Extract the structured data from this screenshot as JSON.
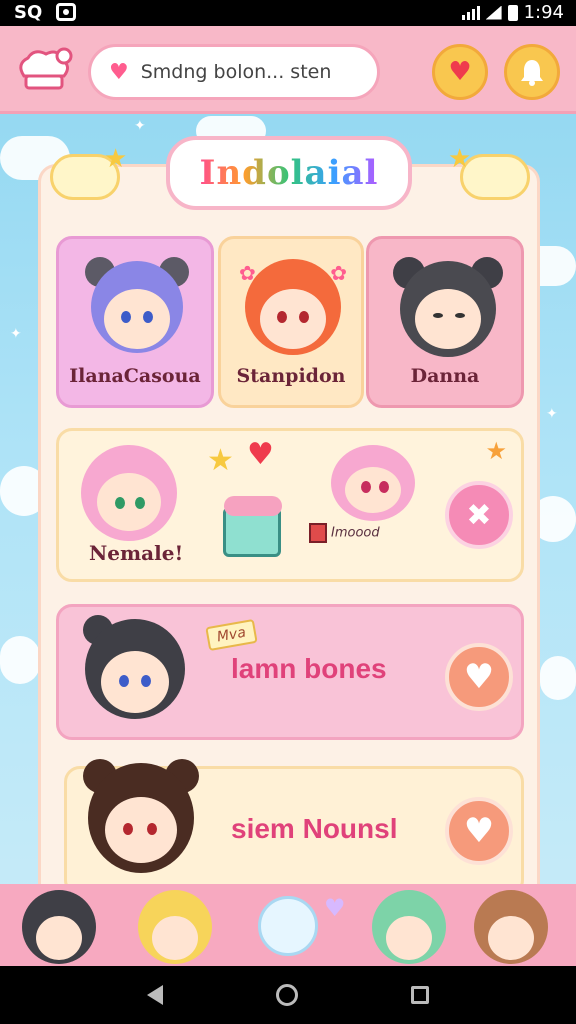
{
  "status": {
    "left": "SQ",
    "time": "1:94"
  },
  "header": {
    "search_text": "Smdng bolon... sten",
    "favorite_icon": "heart-icon",
    "notify_icon": "bell-icon"
  },
  "title": "Indolaial",
  "characters": [
    {
      "name": "IlanaCasoua",
      "hair": "#8a86e6",
      "bg": "#f3b7e6"
    },
    {
      "name": "Stanpidon",
      "hair": "#f46a3c",
      "bg": "#ffe8c4"
    },
    {
      "name": "Danna",
      "hair": "#4a4a50",
      "bg": "#f8b7c8"
    }
  ],
  "rows": [
    {
      "name": "Nemale!",
      "sticker_text": "Imoood"
    },
    {
      "name": "lamn bones",
      "tag": "Mva"
    },
    {
      "name": "siem Nounsl"
    }
  ],
  "colors": {
    "accent": "#e0427a",
    "header": "#f8b8c8",
    "panel": "#fdf1e6",
    "sky": "#8fd6f0"
  }
}
